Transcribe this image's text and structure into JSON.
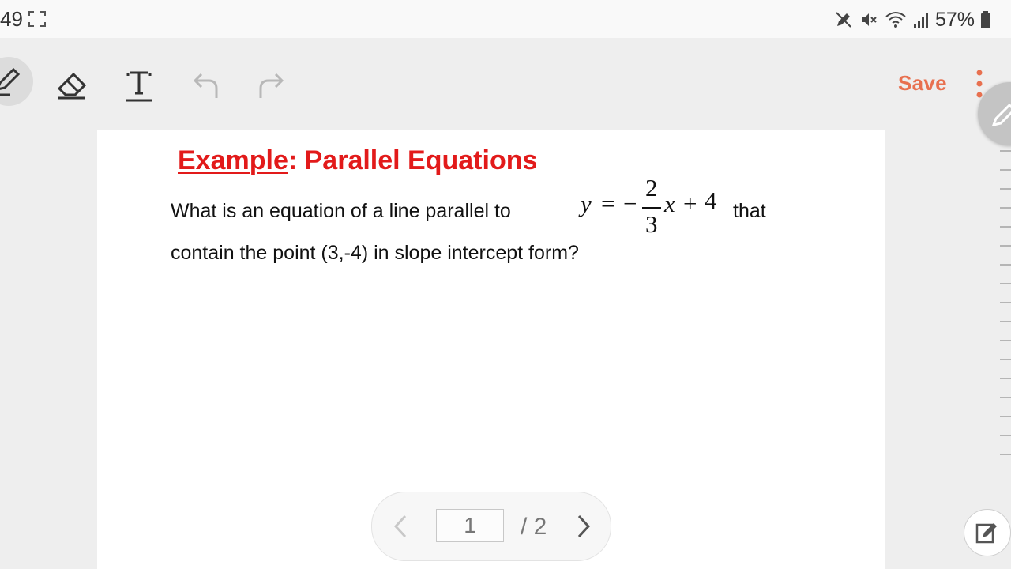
{
  "status_bar": {
    "time": "49",
    "battery": "57%"
  },
  "toolbar": {
    "tools": [
      {
        "name": "pen",
        "icon": "pen-icon",
        "active": true
      },
      {
        "name": "eraser",
        "icon": "eraser-icon"
      },
      {
        "name": "text",
        "icon": "text-icon"
      },
      {
        "name": "undo",
        "icon": "undo-icon"
      },
      {
        "name": "redo",
        "icon": "redo-icon"
      }
    ],
    "save_label": "Save",
    "accent_color": "#e8704f"
  },
  "document": {
    "title_underlined": "Example",
    "title_rest": ": Parallel Equations",
    "title_color": "#e21a1a",
    "question_line1": "What is an equation of a line parallel to",
    "question_that": "that",
    "question_line2": "contain the point (3,-4) in slope intercept form?",
    "equation": {
      "lhs": "y",
      "equals": "=",
      "minus": "−",
      "numerator": "2",
      "denominator": "3",
      "var": "x",
      "plus": "+",
      "constant": "4"
    }
  },
  "pager": {
    "current_page": "1",
    "total": "/ 2"
  }
}
